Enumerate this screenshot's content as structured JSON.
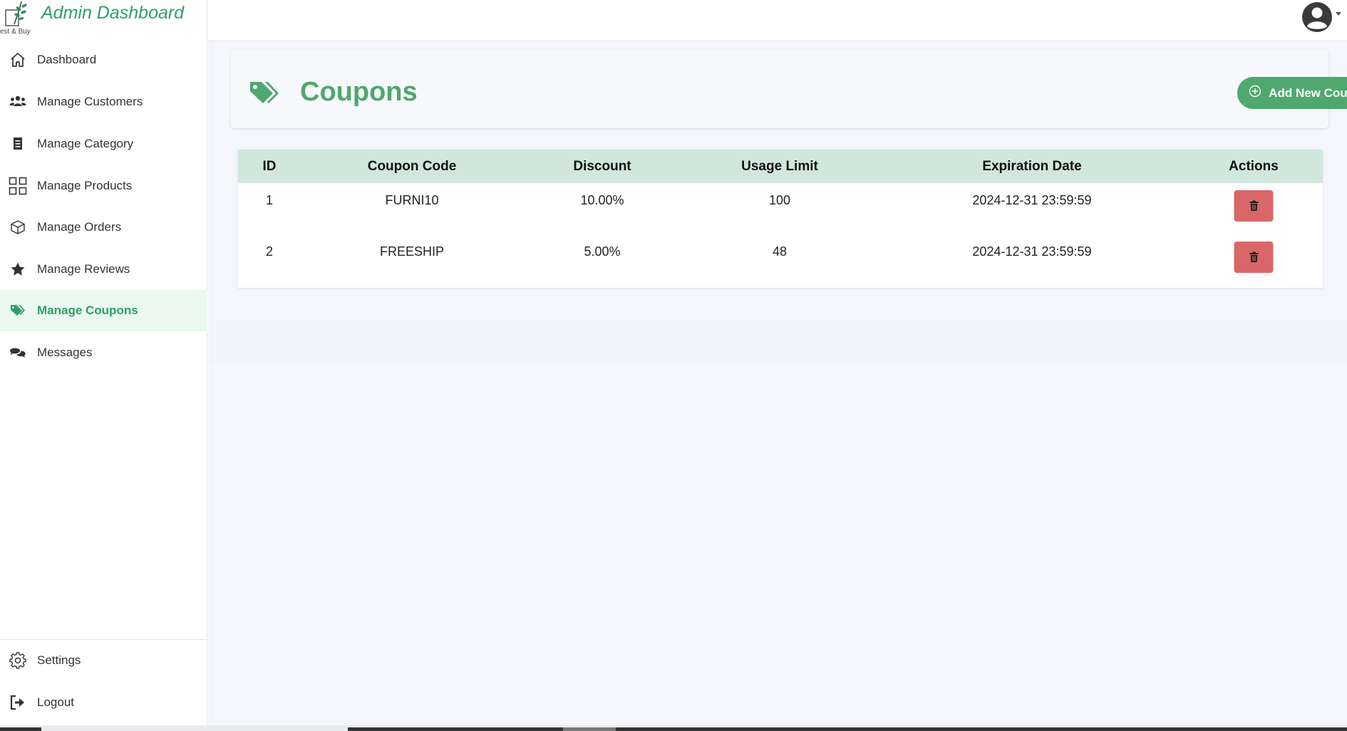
{
  "brand": {
    "title": "Admin Dashboard",
    "logo_text": "est & Buy",
    "accent_color": "#2e9e68"
  },
  "sidebar": {
    "items": [
      {
        "label": "Dashboard",
        "icon": "home-icon"
      },
      {
        "label": "Manage Customers",
        "icon": "users-icon"
      },
      {
        "label": "Manage Category",
        "icon": "list-icon"
      },
      {
        "label": "Manage Products",
        "icon": "grid-icon"
      },
      {
        "label": "Manage Orders",
        "icon": "box-icon"
      },
      {
        "label": "Manage Reviews",
        "icon": "star-icon"
      },
      {
        "label": "Manage Coupons",
        "icon": "tags-icon",
        "active": true
      },
      {
        "label": "Messages",
        "icon": "chat-icon"
      }
    ],
    "bottom_items": [
      {
        "label": "Settings",
        "icon": "gear-icon"
      },
      {
        "label": "Logout",
        "icon": "logout-icon"
      }
    ],
    "active_bg": "#eaf8f0"
  },
  "topbar": {
    "avatar_icon": "user-circle-icon"
  },
  "page": {
    "title": "Coupons",
    "title_icon": "tags-icon",
    "title_color": "#4fa86f",
    "add_button_label": "Add New Coupon",
    "add_button_icon": "plus-circle-icon"
  },
  "table": {
    "headers": [
      "ID",
      "Coupon Code",
      "Discount",
      "Usage Limit",
      "Expiration Date",
      "Actions"
    ],
    "header_bg": "#d1e7dd",
    "rows": [
      {
        "id": "1",
        "code": "FURNI10",
        "discount": "10.00%",
        "usage_limit": "100",
        "expiration": "2024-12-31 23:59:59"
      },
      {
        "id": "2",
        "code": "FREESHIP",
        "discount": "5.00%",
        "usage_limit": "48",
        "expiration": "2024-12-31 23:59:59"
      }
    ],
    "delete_icon": "trash-icon",
    "delete_color": "#d9676a"
  }
}
